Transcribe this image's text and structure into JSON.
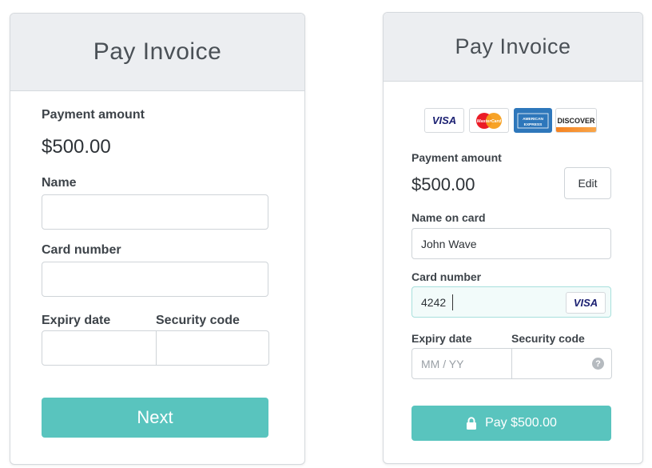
{
  "left_form": {
    "title": "Pay Invoice",
    "payment_amount_label": "Payment amount",
    "payment_amount_value": "$500.00",
    "name_label": "Name",
    "name_value": "",
    "card_number_label": "Card number",
    "card_number_value": "",
    "expiry_label": "Expiry date",
    "security_label": "Security code",
    "next_button_label": "Next"
  },
  "right_form": {
    "title": "Pay Invoice",
    "card_brands": [
      {
        "label": "VISA",
        "icon": "visa-logo"
      },
      {
        "label": "MasterCard",
        "icon": "mastercard-logo"
      },
      {
        "label": "AMERICAN EXPRESS",
        "icon": "amex-logo"
      },
      {
        "label": "DISCOVER",
        "icon": "discover-logo"
      }
    ],
    "payment_amount_label": "Payment amount",
    "payment_amount_value": "$500.00",
    "edit_button_label": "Edit",
    "name_on_card_label": "Name on card",
    "name_on_card_value": "John Wave",
    "card_number_label": "Card number",
    "card_number_value": "4242",
    "card_brand_detected": "VISA",
    "expiry_label": "Expiry date",
    "expiry_placeholder": "MM / YY",
    "security_label": "Security code",
    "pay_button_label": "Pay $500.00",
    "pay_icon": "lock-icon",
    "help_icon": "question-icon"
  },
  "colors": {
    "accent": "#59c4be",
    "header_bg": "#eceef1",
    "focus_border": "#a8e0dc",
    "focus_bg": "#f2fbfa"
  }
}
